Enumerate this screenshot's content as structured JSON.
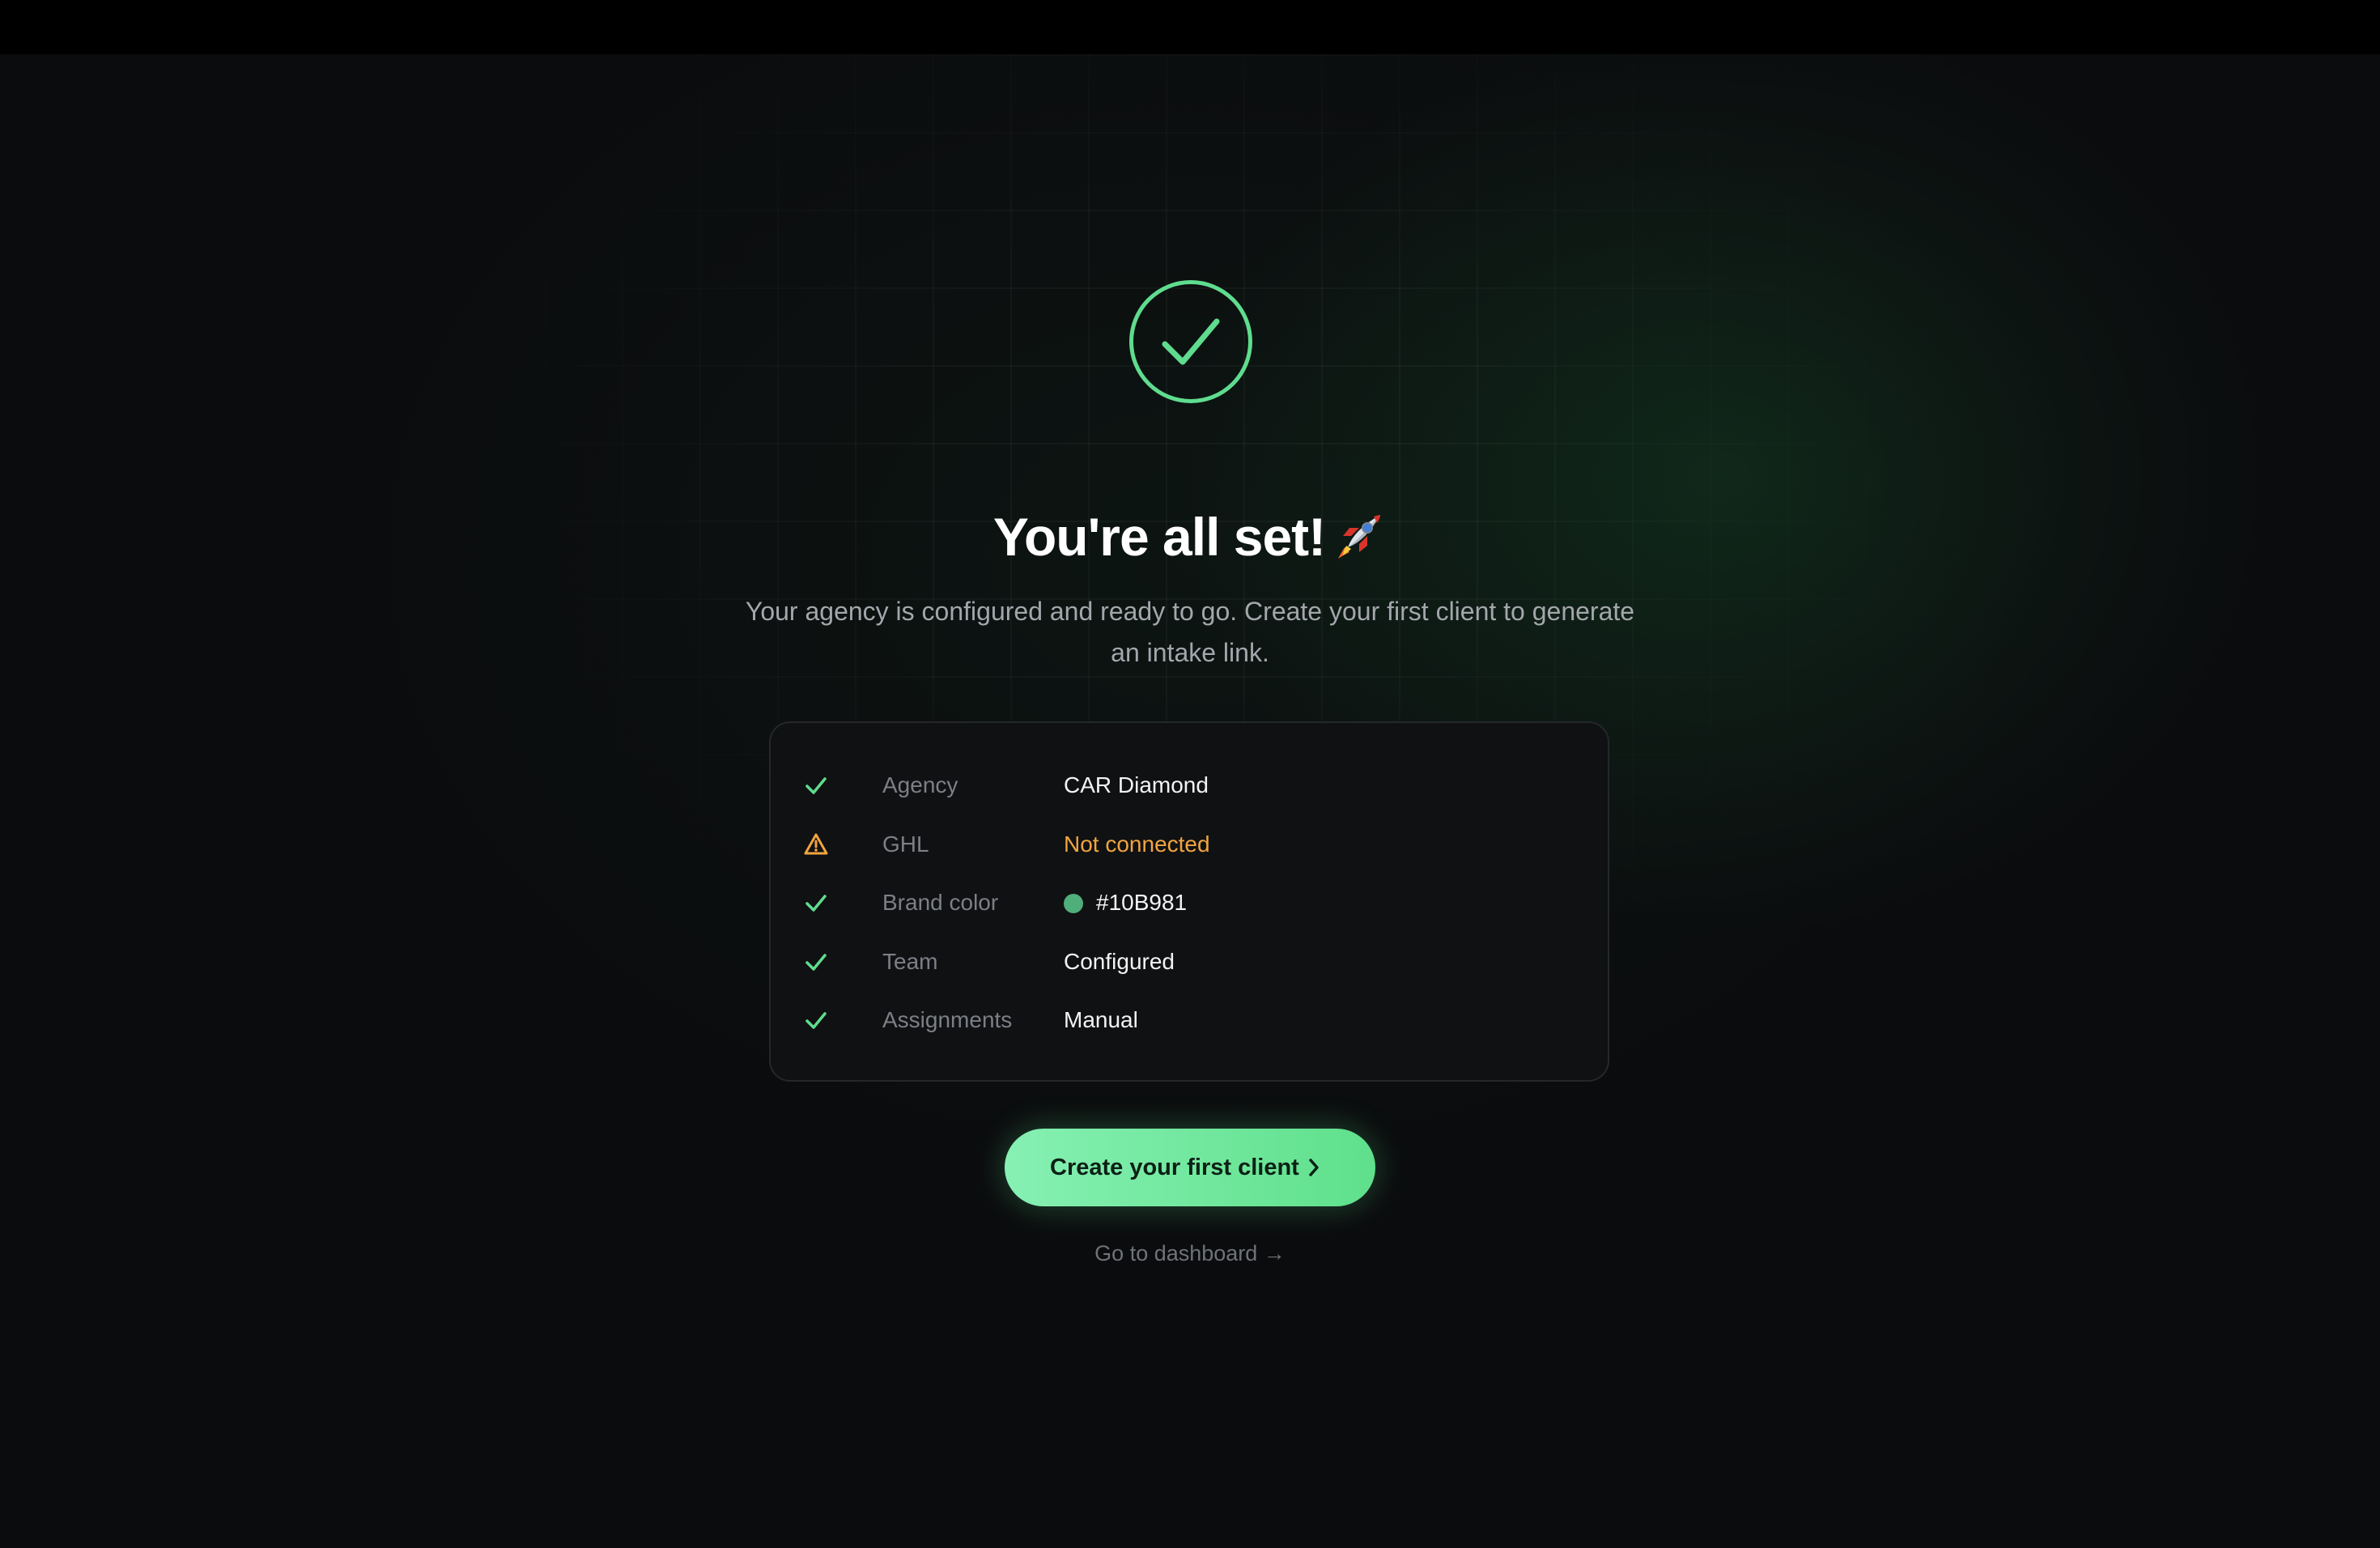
{
  "hero": {
    "icon": "check-circle-icon",
    "title": "You're all set!",
    "title_emoji": "rocket-emoji-icon",
    "subtitle": "Your agency is configured and ready to go. Create your first client to generate an intake link."
  },
  "summary": {
    "rows": [
      {
        "status": "check",
        "label": "Agency",
        "value": "CAR Diamond"
      },
      {
        "status": "warning",
        "label": "GHL",
        "value": "Not connected"
      },
      {
        "status": "check",
        "label": "Brand color",
        "value": "#10B981",
        "swatch": "#10B981"
      },
      {
        "status": "check",
        "label": "Team",
        "value": "Configured"
      },
      {
        "status": "check",
        "label": "Assignments",
        "value": "Manual"
      }
    ]
  },
  "actions": {
    "primary_label": "Create your first client",
    "primary_icon": "chevron-right-icon",
    "secondary_label": "Go to dashboard →"
  },
  "colors": {
    "accent": "#5FDC8E",
    "warning": "#F0A53F",
    "background": "#0B0C0E",
    "card": "#101113"
  }
}
